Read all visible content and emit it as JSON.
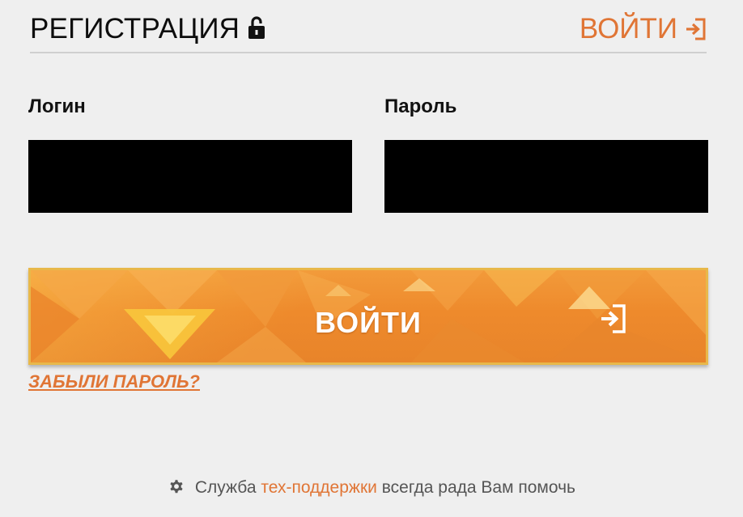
{
  "header": {
    "title": "РЕГИСТРАЦИЯ",
    "login_link": "ВОЙТИ"
  },
  "form": {
    "login_label": "Логин",
    "login_value": "",
    "password_label": "Пароль",
    "password_value": "",
    "submit_label": "ВОЙТИ",
    "forgot_label": "ЗАБЫЛИ ПАРОЛЬ?"
  },
  "support": {
    "prefix": "Служба",
    "link": "тех-поддержки",
    "suffix": "всегда рада Вам помочь"
  },
  "colors": {
    "accent": "#e07535",
    "button": "#ee8a2c",
    "button_border": "#e8b84a",
    "input_bg": "#000000",
    "background": "#efefef"
  },
  "icons": {
    "lock": "lock-icon",
    "enter": "enter-icon",
    "gear": "gear-icon"
  }
}
